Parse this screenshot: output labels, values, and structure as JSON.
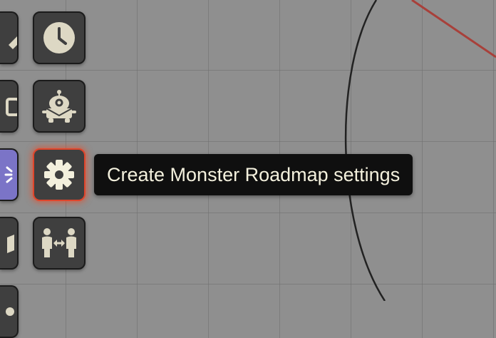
{
  "tooltip": {
    "text": "Create Monster Roadmap settings"
  },
  "toolbar": {
    "buttons": [
      {
        "name": "clock-tool-button",
        "icon": "clock-icon"
      },
      {
        "name": "monster-tool-button",
        "icon": "monster-icon"
      },
      {
        "name": "settings-tool-button",
        "icon": "gear-icon",
        "active": true
      },
      {
        "name": "connect-people-tool-button",
        "icon": "people-arrows-icon"
      }
    ],
    "partial_buttons": [
      {
        "name": "pencil-tool-button",
        "icon": "pencil-icon"
      },
      {
        "name": "layers-tool-button",
        "icon": "layers-icon"
      },
      {
        "name": "sparkle-tool-button",
        "icon": "sparkle-icon"
      },
      {
        "name": "map-tool-button",
        "icon": "map-icon"
      },
      {
        "name": "extra-tool-button",
        "icon": "unknown-icon"
      }
    ]
  },
  "colors": {
    "canvas_background": "#8f8f8f",
    "grid_line": "#6e6e6e",
    "button_background": "#3f3f3f",
    "icon_fill": "#ddd8c4",
    "active_border": "#e0452b",
    "purple_button": "#7b74c7",
    "tooltip_background": "#0f0f0f",
    "tooltip_text": "#f3f0dd",
    "red_connector": "#a8403a"
  }
}
